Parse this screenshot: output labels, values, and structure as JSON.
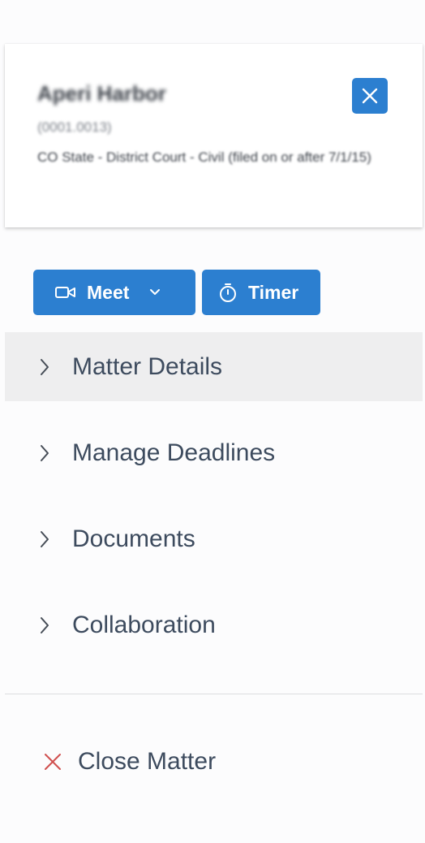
{
  "matter": {
    "name": "Aperi Harbor",
    "number": "(0001.0013)",
    "court": "CO State - District Court - Civil (filed on or after 7/1/15)",
    "close_icon": "close-icon"
  },
  "actions": {
    "meet": {
      "label": "Meet",
      "icon": "video-camera-icon",
      "dropdown_icon": "chevron-down-icon"
    },
    "timer": {
      "label": "Timer",
      "icon": "stopwatch-icon"
    }
  },
  "nav": {
    "items": [
      {
        "label": "Matter Details",
        "icon": "chevron-right-icon",
        "active": true
      },
      {
        "label": "Manage Deadlines",
        "icon": "chevron-right-icon",
        "active": false
      },
      {
        "label": "Documents",
        "icon": "chevron-right-icon",
        "active": false
      },
      {
        "label": "Collaboration",
        "icon": "chevron-right-icon",
        "active": false
      }
    ]
  },
  "footer": {
    "close_matter_label": "Close Matter",
    "close_matter_icon": "x-icon"
  },
  "colors": {
    "primary": "#2c7fd0",
    "active_bg": "#eeeeef",
    "nav_text": "#3d4b5e",
    "close_x": "#d0504f"
  }
}
